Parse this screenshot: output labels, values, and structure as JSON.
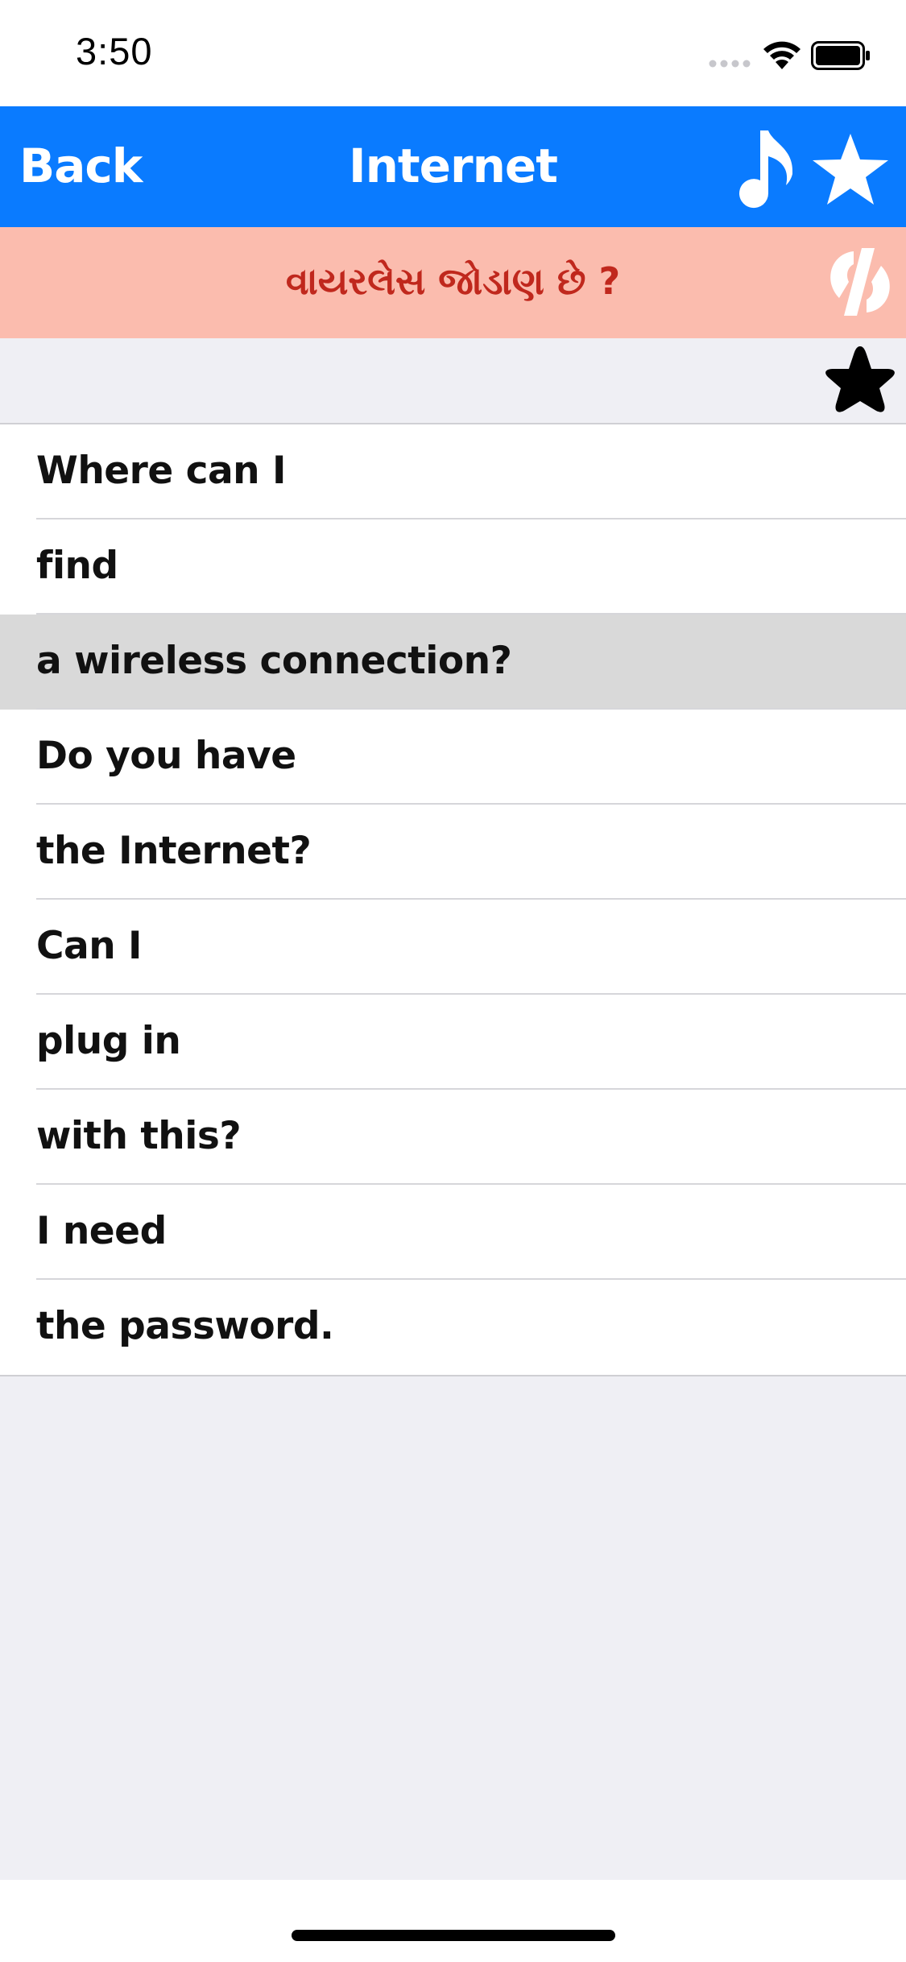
{
  "status_bar": {
    "time": "3:50",
    "icons": [
      "signal-dots-icon",
      "wifi-icon",
      "battery-icon"
    ]
  },
  "nav": {
    "back_label": "Back",
    "title": "Internet",
    "icons": [
      "music-note-icon",
      "star-icon"
    ],
    "background_color": "#0a7bff"
  },
  "translation": {
    "text": "વાયરલેસ જોડાણ છે ?",
    "text_color": "#c0281d",
    "background_color": "#fbbcae",
    "icon": "swap-language-icon"
  },
  "favorite": {
    "icon": "star-icon"
  },
  "phrases": [
    {
      "label": "Where can I",
      "selected": false
    },
    {
      "label": "find",
      "selected": false
    },
    {
      "label": "a wireless connection?",
      "selected": true
    },
    {
      "label": "Do you have",
      "selected": false
    },
    {
      "label": "the Internet?",
      "selected": false
    },
    {
      "label": "Can I",
      "selected": false
    },
    {
      "label": "plug in",
      "selected": false
    },
    {
      "label": "with this?",
      "selected": false
    },
    {
      "label": "I need",
      "selected": false
    },
    {
      "label": "the password.",
      "selected": false
    }
  ]
}
